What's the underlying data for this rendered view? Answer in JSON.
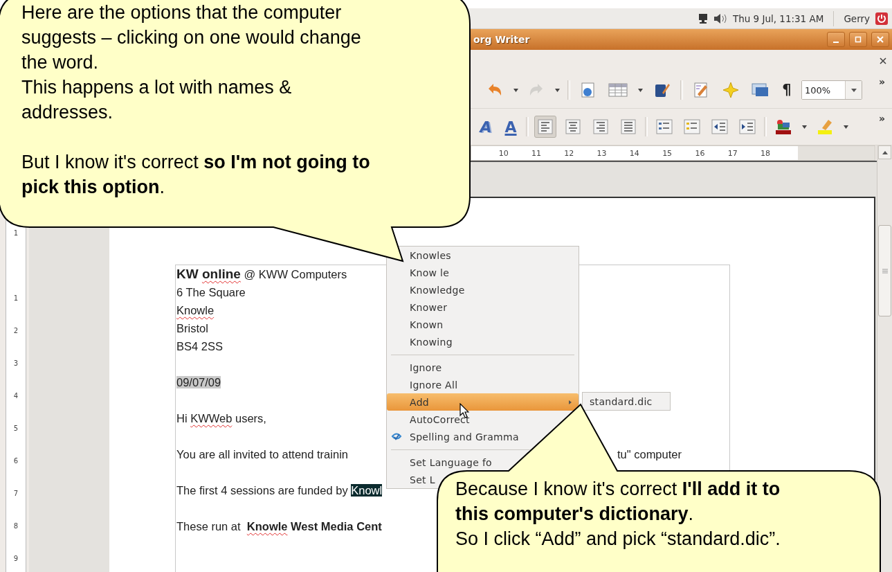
{
  "top_panel": {
    "datetime": "Thu 9 Jul, 11:31 AM",
    "user": "Gerry"
  },
  "window": {
    "title": "org Writer"
  },
  "standard_toolbar": {
    "formatting_marks": "¶",
    "zoom": "100%",
    "overflow": "»"
  },
  "formatting_toolbar": {
    "font_effects": [
      "A",
      "A"
    ],
    "alignment": [
      {
        "selected": true
      },
      {
        "selected": false
      },
      {
        "selected": false
      },
      {
        "selected": false
      }
    ],
    "overflow": "»"
  },
  "ruler": {
    "labels": [
      "10",
      "11",
      "12",
      "13",
      "14",
      "15",
      "16",
      "17",
      "18"
    ]
  },
  "vertical_ruler": {
    "labels": [
      "1",
      "1",
      "2",
      "3",
      "4",
      "5",
      "6",
      "7",
      "8",
      "9"
    ]
  },
  "document": {
    "address": [
      {
        "segments": [
          {
            "text": "**KW** ",
            "misspelled": false,
            "shaded": false,
            "selected": false
          },
          {
            "text": "**online**",
            "misspelled": true,
            "shaded": false,
            "selected": false
          },
          {
            "text": " @ KWW Computers",
            "misspelled": false,
            "shaded": false,
            "selected": false
          }
        ]
      },
      {
        "segments": [
          {
            "text": "6 The Square",
            "misspelled": false,
            "shaded": false,
            "selected": false
          }
        ]
      },
      {
        "segments": [
          {
            "text": "Knowle",
            "misspelled": true,
            "shaded": false,
            "selected": false
          }
        ]
      },
      {
        "segments": [
          {
            "text": "Bristol",
            "misspelled": false,
            "shaded": false,
            "selected": false
          }
        ]
      },
      {
        "segments": [
          {
            "text": "BS4 2SS",
            "misspelled": false,
            "shaded": false,
            "selected": false
          }
        ]
      }
    ],
    "paragraphs": [
      {
        "segments": [
          {
            "text": "09/07/09",
            "misspelled": false,
            "shaded": true,
            "selected": false
          }
        ]
      },
      {
        "segments": [
          {
            "text": "Hi ",
            "misspelled": false,
            "shaded": false,
            "selected": false
          },
          {
            "text": "KWWeb",
            "misspelled": true,
            "shaded": false,
            "selected": false
          },
          {
            "text": " users,",
            "misspelled": false,
            "shaded": false,
            "selected": false
          }
        ]
      },
      {
        "segments": [
          {
            "text": "You are all invited to attend trainin",
            "misspelled": false,
            "shaded": false,
            "selected": false
          }
        ],
        "fragment": "tu\" computer"
      },
      {
        "segments": [
          {
            "text": "The first 4 sessions are funded by ",
            "misspelled": false,
            "shaded": false,
            "selected": false
          },
          {
            "text": "Knowl",
            "misspelled": false,
            "shaded": false,
            "selected": true
          }
        ]
      },
      {
        "segments": [
          {
            "text": "These run at  ",
            "misspelled": false,
            "shaded": false,
            "selected": false
          },
          {
            "text": "**Knowle**",
            "misspelled": true,
            "shaded": false,
            "selected": false
          },
          {
            "text": " **West Media Cent**",
            "misspelled": false,
            "shaded": false,
            "selected": false
          }
        ]
      }
    ]
  },
  "context_menu": {
    "groups": [
      {
        "items": [
          {
            "label": "Knowles",
            "kind": "text",
            "selected": false
          },
          {
            "label": "Know le",
            "kind": "text",
            "selected": false
          },
          {
            "label": "Knowledge",
            "kind": "text",
            "selected": false
          },
          {
            "label": "Knower",
            "kind": "text",
            "selected": false
          },
          {
            "label": "Known",
            "kind": "text",
            "selected": false
          },
          {
            "label": "Knowing",
            "kind": "text",
            "selected": false
          }
        ]
      },
      {
        "items": [
          {
            "label": "Ignore",
            "kind": "text",
            "selected": false
          },
          {
            "label": "Ignore All",
            "kind": "text",
            "selected": false
          },
          {
            "label": "Add",
            "kind": "text",
            "selected": true,
            "submenu": [
              "standard.dic"
            ]
          },
          {
            "label": "AutoCorrect",
            "kind": "text",
            "selected": false
          },
          {
            "label": "Spelling and Gramma",
            "kind": "with-icon",
            "selected": false
          }
        ]
      },
      {
        "items": [
          {
            "label": "Set Language fo",
            "kind": "text",
            "selected": false
          },
          {
            "label": "Set L",
            "kind": "text",
            "selected": false
          }
        ]
      }
    ]
  },
  "callouts": [
    {
      "paragraphs": [
        [
          "Here are the options that the computer",
          "suggests – clicking on one would change",
          "the word.",
          "This happens a lot with names &",
          "addresses."
        ],
        [
          "But I know it's correct **so I'm not going to**",
          "**pick this option**."
        ]
      ]
    },
    {
      "paragraphs": [
        [
          "Because I know it's correct **I'll add it to**",
          "**this computer's dictionary**.",
          "So I click “Add” and pick “standard.dic”."
        ]
      ]
    }
  ]
}
